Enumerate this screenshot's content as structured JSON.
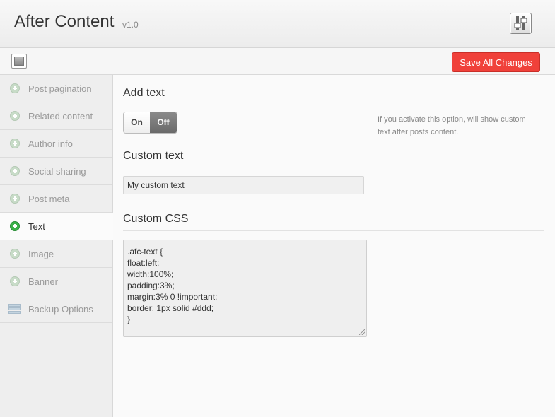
{
  "header": {
    "title": "After Content",
    "version": "v1.0",
    "icon": "sliders-icon"
  },
  "toolbar": {
    "save_label": "Save All Changes",
    "save_color": "#f0413a"
  },
  "sidebar": {
    "items": [
      {
        "label": "Post pagination",
        "icon": "plus-circle-icon",
        "active": false
      },
      {
        "label": "Related content",
        "icon": "plus-circle-icon",
        "active": false
      },
      {
        "label": "Author info",
        "icon": "plus-circle-icon",
        "active": false
      },
      {
        "label": "Social sharing",
        "icon": "plus-circle-icon",
        "active": false
      },
      {
        "label": "Post meta",
        "icon": "plus-circle-icon",
        "active": false
      },
      {
        "label": "Text",
        "icon": "plus-circle-icon",
        "active": true
      },
      {
        "label": "Image",
        "icon": "plus-circle-icon",
        "active": false
      },
      {
        "label": "Banner",
        "icon": "plus-circle-icon",
        "active": false
      },
      {
        "label": "Backup Options",
        "icon": "list-icon",
        "active": false
      }
    ]
  },
  "main": {
    "add_text": {
      "title": "Add text",
      "on_label": "On",
      "off_label": "Off",
      "selected": "Off",
      "help": "If you activate this option, will show custom text after posts content."
    },
    "custom_text": {
      "title": "Custom text",
      "value": "My custom text"
    },
    "custom_css": {
      "title": "Custom CSS",
      "value": ".afc-text {\nfloat:left;\nwidth:100%;\npadding:3%;\nmargin:3% 0 !important;\nborder: 1px solid #ddd;\n}"
    }
  },
  "colors": {
    "accent_green": "#3cb14a",
    "save_red": "#f0413a"
  }
}
